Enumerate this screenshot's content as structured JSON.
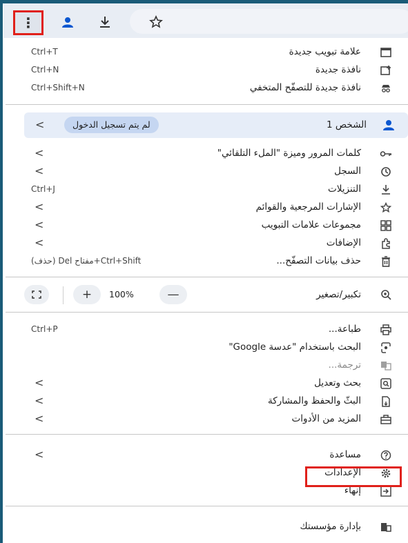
{
  "colors": {
    "accent": "#0b57d0",
    "highlight": "#e0201a",
    "profile_bg": "#e6edf8",
    "pill_bg": "#c5d6f1"
  },
  "toolbar": {
    "menu_glyph": "⋮",
    "icons": [
      "profile-icon",
      "download-icon",
      "bookmark-star-icon"
    ]
  },
  "section1": [
    {
      "label": "علامة تبويب جديدة",
      "shortcut": "Ctrl+T",
      "icon": "new-tab-icon"
    },
    {
      "label": "نافذة جديدة",
      "shortcut": "Ctrl+N",
      "icon": "new-window-icon"
    },
    {
      "label": "نافذة جديدة للتصفّح المتخفي",
      "shortcut": "Ctrl+Shift+N",
      "icon": "incognito-icon"
    }
  ],
  "profile": {
    "name": "الشخص 1",
    "status": "لم يتم تسجيل الدخول",
    "chevron": "<"
  },
  "section2": [
    {
      "label": "كلمات المرور وميزة \"الملء التلقائي\"",
      "right": "<",
      "icon": "key-icon"
    },
    {
      "label": "السجل",
      "right": "<",
      "icon": "history-icon"
    },
    {
      "label": "التنزيلات",
      "right": "Ctrl+J",
      "icon": "download-icon"
    },
    {
      "label": "الإشارات المرجعية والقوائم",
      "right": "<",
      "icon": "star-icon"
    },
    {
      "label": "مجموعات علامات التبويب",
      "right": "<",
      "icon": "tab-groups-icon"
    },
    {
      "label": "الإضافات",
      "right": "<",
      "icon": "extensions-icon"
    },
    {
      "label": "حذف بيانات التصفّح...",
      "right": "Ctrl+Shift+مفتاح Del (حذف)",
      "icon": "trash-icon"
    }
  ],
  "zoom": {
    "label": "تكبير/تصغير",
    "minus": "—",
    "value": "100%",
    "plus": "+",
    "icon": "zoom-icon"
  },
  "section3": [
    {
      "label": "طباعة...",
      "right": "Ctrl+P",
      "icon": "print-icon",
      "disabled": false
    },
    {
      "label": "البحث باستخدام \"عدسة Google\"",
      "right": "",
      "icon": "lens-icon",
      "disabled": false
    },
    {
      "label": "ترجمة...",
      "right": "",
      "icon": "translate-icon",
      "disabled": true
    },
    {
      "label": "بحث وتعديل",
      "right": "<",
      "icon": "find-icon",
      "disabled": false
    },
    {
      "label": "البثّ والحفظ والمشاركة",
      "right": "<",
      "icon": "cast-icon",
      "disabled": false
    },
    {
      "label": "المزيد من الأدوات",
      "right": "<",
      "icon": "toolbox-icon",
      "disabled": false
    }
  ],
  "section4": [
    {
      "label": "مساعدة",
      "right": "<",
      "icon": "help-icon"
    },
    {
      "label": "الإعدادات",
      "right": "",
      "icon": "settings-icon"
    },
    {
      "label": "إنهاء",
      "right": "",
      "icon": "exit-icon"
    }
  ],
  "managed": {
    "label": "بإدارة مؤسستك",
    "icon": "enterprise-icon"
  }
}
